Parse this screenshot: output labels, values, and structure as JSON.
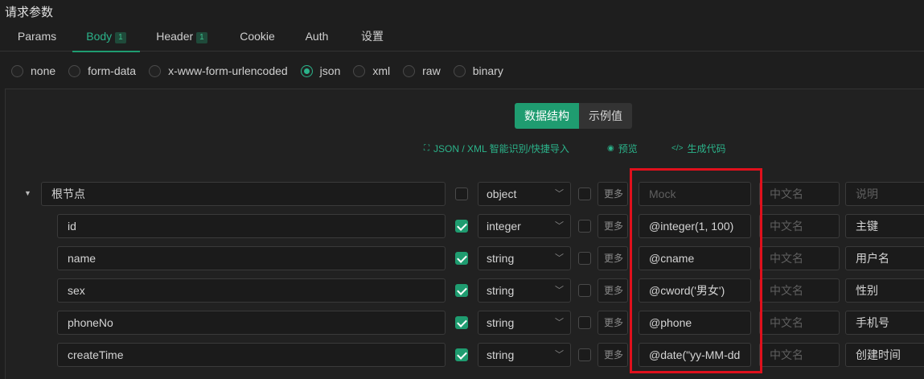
{
  "section_title": "请求参数",
  "tabs": [
    {
      "label": "Params",
      "badge": ""
    },
    {
      "label": "Body",
      "badge": "1"
    },
    {
      "label": "Header",
      "badge": "1"
    },
    {
      "label": "Cookie",
      "badge": ""
    },
    {
      "label": "Auth",
      "badge": ""
    },
    {
      "label": "设置",
      "badge": ""
    }
  ],
  "body_types": [
    "none",
    "form-data",
    "x-www-form-urlencoded",
    "json",
    "xml",
    "raw",
    "binary"
  ],
  "selected_body_type": "json",
  "view_toggle": {
    "structure": "数据结构",
    "example": "示例值"
  },
  "toolbar": {
    "import_label": "JSON / XML 智能识别/快捷导入",
    "preview_label": "预览",
    "generate_label": "生成代码"
  },
  "root": {
    "name": "根节点",
    "type": "object",
    "more": "更多",
    "mock_placeholder": "Mock",
    "cn_placeholder": "中文名",
    "desc_placeholder": "说明"
  },
  "fields": [
    {
      "name": "id",
      "type": "integer",
      "more": "更多",
      "mock": "@integer(1, 100)",
      "cn_placeholder": "中文名",
      "desc": "主键"
    },
    {
      "name": "name",
      "type": "string",
      "more": "更多",
      "mock": "@cname",
      "cn_placeholder": "中文名",
      "desc": "用户名"
    },
    {
      "name": "sex",
      "type": "string",
      "more": "更多",
      "mock": "@cword('男女')",
      "cn_placeholder": "中文名",
      "desc": "性别"
    },
    {
      "name": "phoneNo",
      "type": "string",
      "more": "更多",
      "mock": "@phone",
      "cn_placeholder": "中文名",
      "desc": "手机号"
    },
    {
      "name": "createTime",
      "type": "string",
      "more": "更多",
      "mock": "@date(\"yy-MM-dd",
      "cn_placeholder": "中文名",
      "desc": "创建时间"
    }
  ],
  "colors": {
    "accent": "#1f9c70",
    "highlight": "#e0101c",
    "background": "#1e1e1e"
  }
}
